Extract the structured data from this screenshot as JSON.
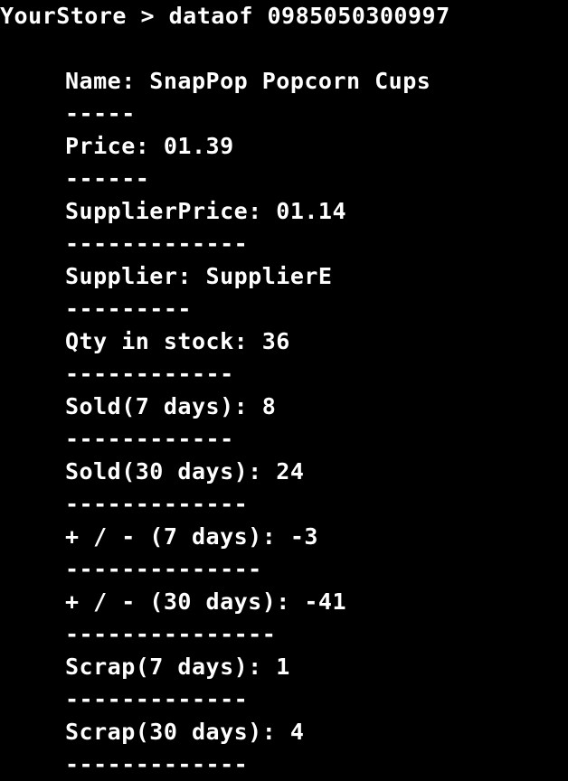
{
  "terminal": {
    "prompt": "YourStore > dataof 0985050300997",
    "lines": [
      "Name: SnapPop Popcorn Cups",
      "-----",
      "Price: 01.39",
      "------",
      "SupplierPrice: 01.14",
      "-------------",
      "Supplier: SupplierE",
      "---------",
      "Qty in stock: 36",
      "------------",
      "Sold(7 days): 8",
      "------------",
      "Sold(30 days): 24",
      "-------------",
      "+ / - (7 days): -3",
      "--------------",
      "+ / - (30 days): -41",
      "---------------",
      "Scrap(7 days): 1",
      "-------------",
      "Scrap(30 days): 4",
      "-------------"
    ]
  }
}
